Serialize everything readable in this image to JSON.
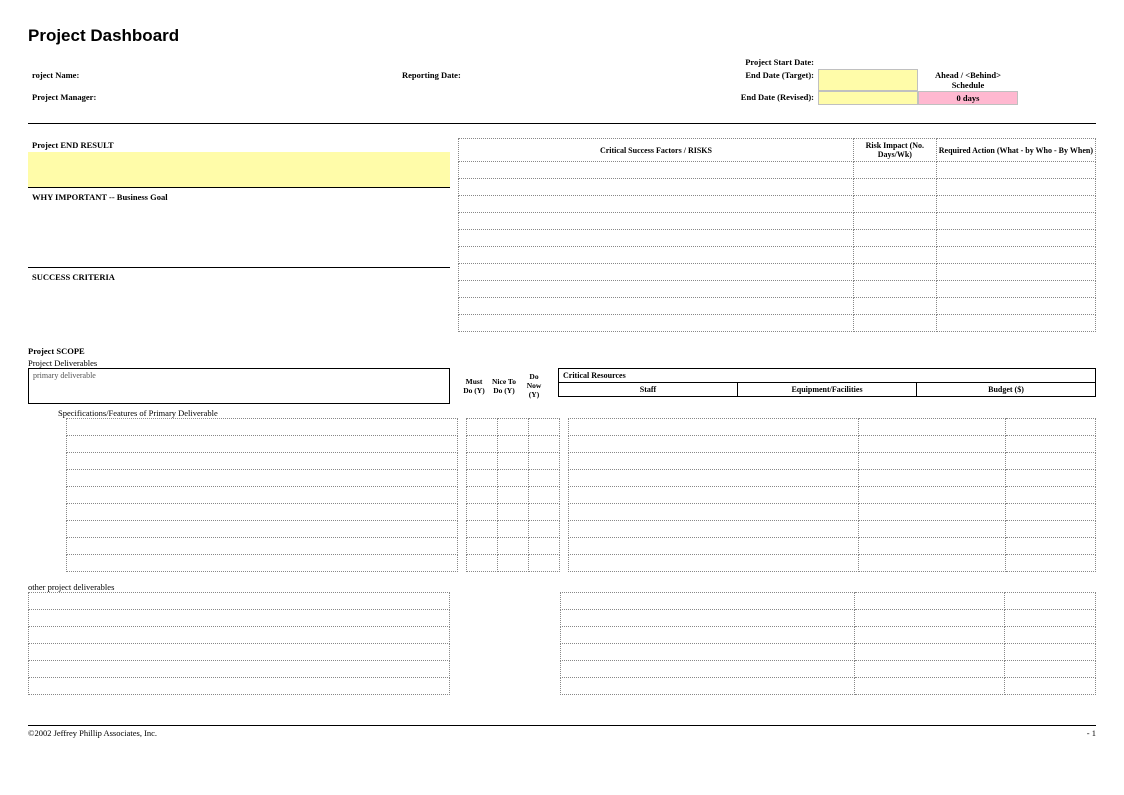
{
  "title": "Project Dashboard",
  "header": {
    "project_name_label": "roject Name:",
    "project_manager_label": "Project Manager:",
    "reporting_date_label": "Reporting Date:",
    "start_date_label": "Project Start Date:",
    "end_date_target_label": "End Date (Target):",
    "end_date_revised_label": "End Date (Revised):",
    "schedule_label": "Ahead / <Behind>  Schedule",
    "schedule_value": "0 days"
  },
  "sections": {
    "end_result": "Project END RESULT",
    "why_important": "WHY IMPORTANT   --   Business Goal",
    "success_criteria": "SUCCESS CRITERIA",
    "csf_risks": "Critical Success Factors  /  RISKS",
    "risk_impact": "Risk Impact (No. Days/Wk)",
    "required_action": "Required Action   (What - by Who - By When)",
    "scope": "Project SCOPE",
    "deliverables": "Project Deliverables",
    "primary_deliverable_placeholder": "primary deliverable",
    "specs": "Specifications/Features of Primary Deliverable",
    "other_deliverables": "other project deliverables",
    "must_do": "Must Do (Y)",
    "nice_to_do": "Nice To Do (Y)",
    "do_now": "Do Now (Y)",
    "critical_resources": "Critical Resources",
    "staff": "Staff",
    "equipment": "Equipment/Facilities",
    "budget": "Budget ($)"
  },
  "footer": {
    "copyright": "©2002 Jeffrey Phillip Associates, Inc.",
    "page": "- 1"
  }
}
